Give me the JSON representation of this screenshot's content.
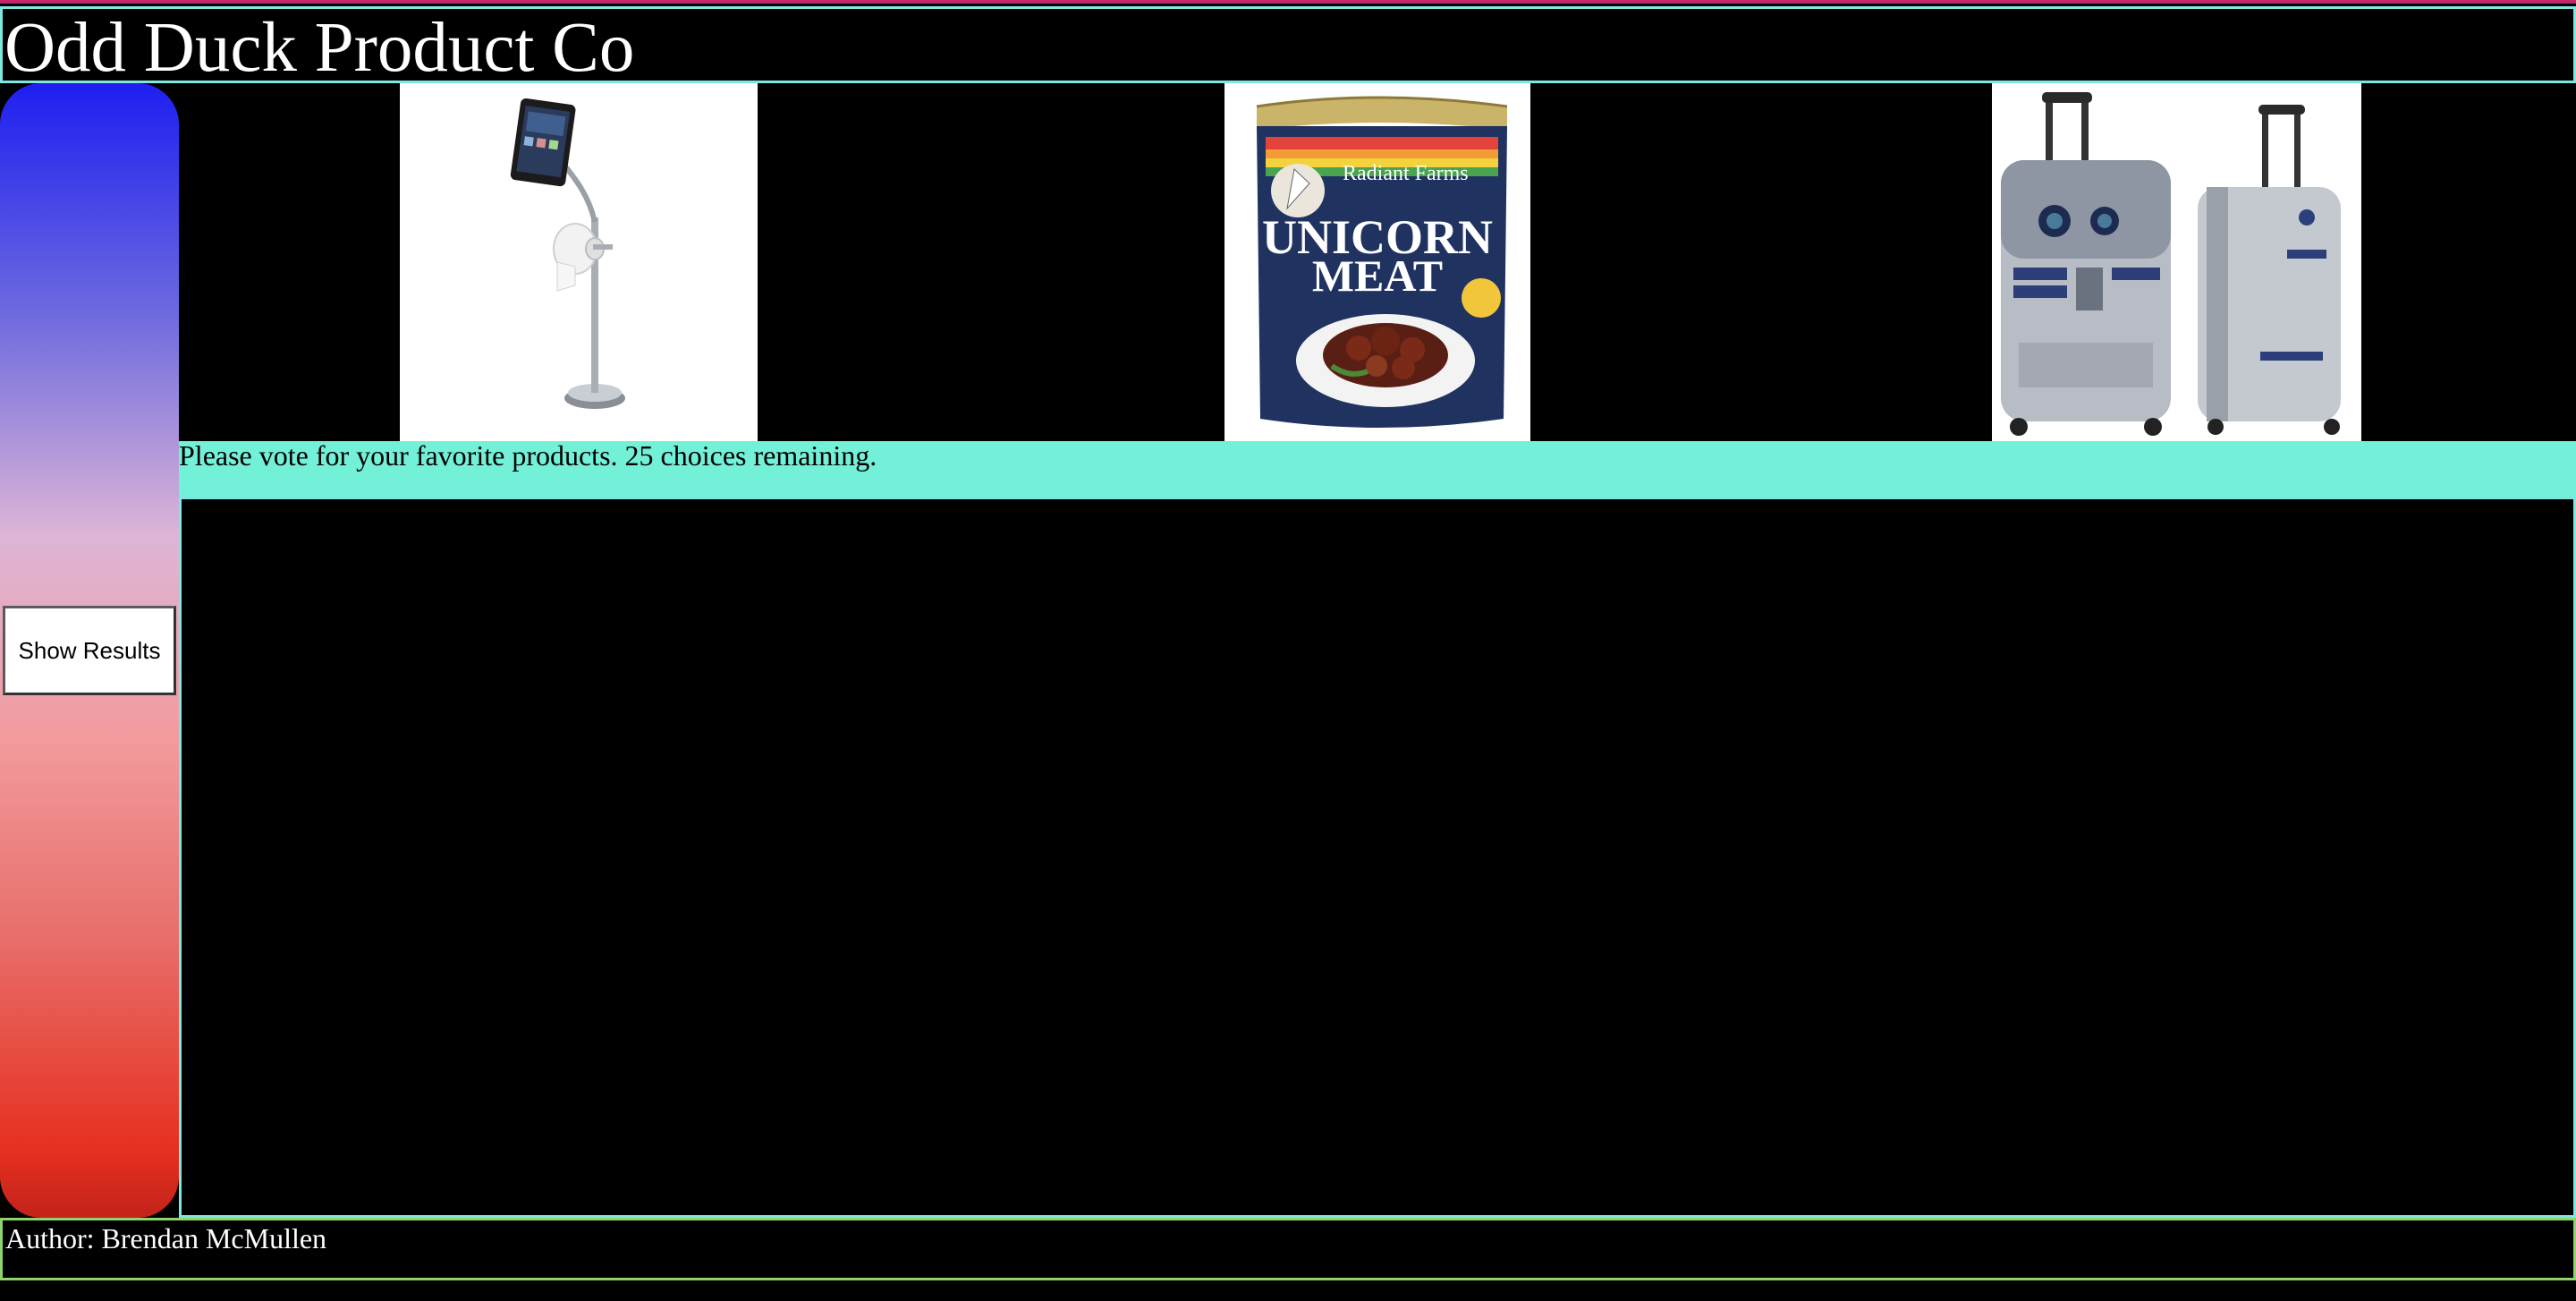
{
  "header": {
    "title": "Odd Duck Product Co"
  },
  "sidebar": {
    "show_results_label": "Show Results"
  },
  "products": [
    {
      "name": "tablet-toilet-paper-stand",
      "icon": "product-image-bathroom"
    },
    {
      "name": "unicorn-meat-can",
      "icon": "product-image-unicorn-meat",
      "label_brand": "Radiant Farms",
      "label_title_1": "UNICORN",
      "label_title_2": "MEAT"
    },
    {
      "name": "r2d2-suitcase",
      "icon": "product-image-r2d2-bag"
    }
  ],
  "vote": {
    "message": "Please vote for your favorite products. 25 choices remaining."
  },
  "footer": {
    "author": "Author: Brendan McMullen"
  },
  "colors": {
    "header_border": "#7ee7e0",
    "vote_bar": "#73f0d8",
    "footer_border": "#8fd36b",
    "sidebar_top": "#1e1ff0",
    "sidebar_bottom": "#c2231a"
  }
}
